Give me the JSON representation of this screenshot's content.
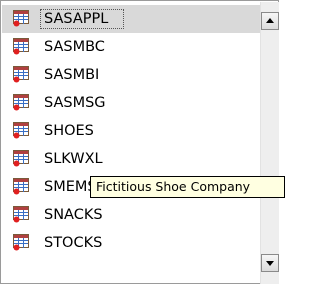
{
  "listbox": {
    "items": [
      {
        "label": "SASAPPL",
        "selected": true
      },
      {
        "label": "SASMBC",
        "selected": false
      },
      {
        "label": "SASMBI",
        "selected": false
      },
      {
        "label": "SASMSG",
        "selected": false
      },
      {
        "label": "SHOES",
        "selected": false
      },
      {
        "label": "SLKWXL",
        "selected": false
      },
      {
        "label": "SMEMSG",
        "selected": false
      },
      {
        "label": "SNACKS",
        "selected": false
      },
      {
        "label": "STOCKS",
        "selected": false
      }
    ],
    "item_icon": "sas-library-table-icon"
  },
  "tooltip": {
    "text": "Fictitious Shoe Company"
  },
  "colors": {
    "selection": "#d9d9d9",
    "tooltip_bg": "#ffffe1",
    "icon_red": "#e02020",
    "icon_blue": "#3a6fc4"
  }
}
